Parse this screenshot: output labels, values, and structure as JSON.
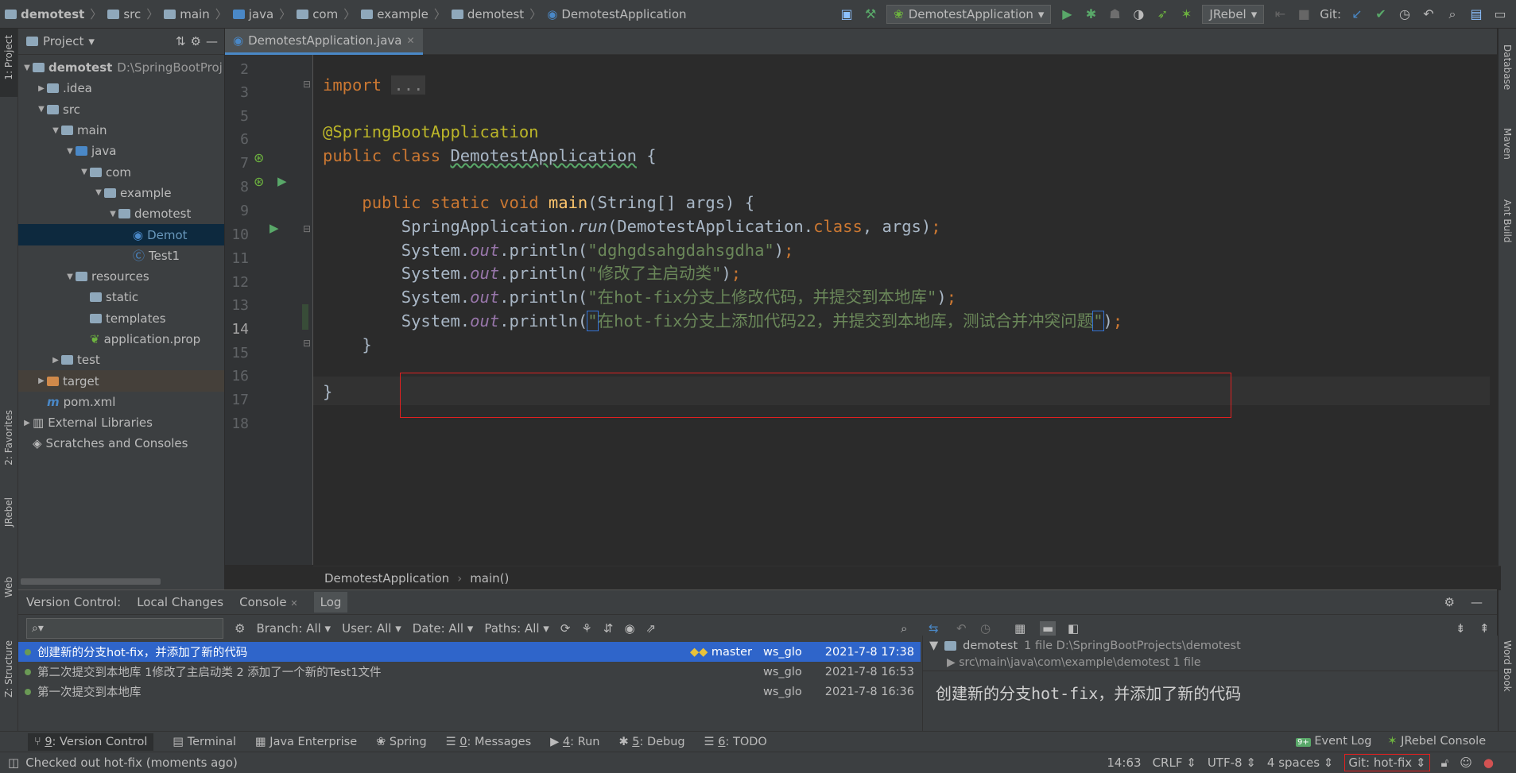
{
  "breadcrumb": [
    "demotest",
    "src",
    "main",
    "java",
    "com",
    "example",
    "demotest",
    "DemotestApplication"
  ],
  "toolbar": {
    "run_config": "DemotestApplication",
    "jrebel": "JRebel",
    "git_label": "Git:"
  },
  "left_strip": {
    "project": "1: Project",
    "favorites": "2: Favorites",
    "jrebel": "JRebel",
    "web": "Web",
    "structure": "Z: Structure"
  },
  "right_strip": {
    "database": "Database",
    "maven": "Maven",
    "ant": "Ant Build",
    "wordbook": "Word Book"
  },
  "project_panel": {
    "title": "Project",
    "tree": [
      {
        "label": "demotest",
        "extra": "D:\\SpringBootProj",
        "depth": 0,
        "arrow": "▼",
        "icon": "folder"
      },
      {
        "label": ".idea",
        "depth": 1,
        "arrow": "▶",
        "icon": "folder"
      },
      {
        "label": "src",
        "depth": 1,
        "arrow": "▼",
        "icon": "folder"
      },
      {
        "label": "main",
        "depth": 2,
        "arrow": "▼",
        "icon": "folder"
      },
      {
        "label": "java",
        "depth": 3,
        "arrow": "▼",
        "icon": "folder-blue"
      },
      {
        "label": "com",
        "depth": 4,
        "arrow": "▼",
        "icon": "folder"
      },
      {
        "label": "example",
        "depth": 5,
        "arrow": "▼",
        "icon": "folder"
      },
      {
        "label": "demotest",
        "depth": 6,
        "arrow": "▼",
        "icon": "folder"
      },
      {
        "label": "Demot",
        "depth": 7,
        "arrow": "",
        "icon": "spring-class",
        "selected": true
      },
      {
        "label": "Test1",
        "depth": 7,
        "arrow": "",
        "icon": "class"
      },
      {
        "label": "resources",
        "depth": 3,
        "arrow": "▼",
        "icon": "folder"
      },
      {
        "label": "static",
        "depth": 4,
        "arrow": "",
        "icon": "folder"
      },
      {
        "label": "templates",
        "depth": 4,
        "arrow": "",
        "icon": "folder"
      },
      {
        "label": "application.prop",
        "depth": 4,
        "arrow": "",
        "icon": "spring-leaf"
      },
      {
        "label": "test",
        "depth": 2,
        "arrow": "▶",
        "icon": "folder"
      },
      {
        "label": "target",
        "depth": 1,
        "arrow": "▶",
        "icon": "folder-orange",
        "highlight": true
      },
      {
        "label": "pom.xml",
        "depth": 1,
        "arrow": "",
        "icon": "maven"
      },
      {
        "label": "External Libraries",
        "depth": 0,
        "arrow": "▶",
        "icon": "lib"
      },
      {
        "label": "Scratches and Consoles",
        "depth": 0,
        "arrow": "",
        "icon": "scratch"
      }
    ]
  },
  "editor": {
    "tab": "DemotestApplication.java",
    "line_numbers": [
      "2",
      "3",
      "5",
      "6",
      "7",
      "8",
      "9",
      "10",
      "11",
      "12",
      "13",
      "14",
      "15",
      "16",
      "17",
      "18"
    ],
    "current_line": "14",
    "string_1": "\"dghgdsahgdahsgdha\"",
    "string_2": "\"修改了主启动类\"",
    "string_3": "\"在hot-fix分支上修改代码，并提交到本地库\"",
    "string_4": "在hot-fix分支上添加代码22，并提交到本地库，测试合并冲突问题",
    "breadcrumb_class": "DemotestApplication",
    "breadcrumb_method": "main()"
  },
  "vcs": {
    "tabs": [
      "Version Control:",
      "Local Changes",
      "Console",
      "Log"
    ],
    "filters": [
      "Branch: All",
      "User: All",
      "Date: All",
      "Paths: All"
    ],
    "log": [
      {
        "msg": "创建新的分支hot-fix，并添加了新的代码",
        "tag": "master",
        "author": "ws_glo",
        "date": "2021-7-8 17:38",
        "selected": true
      },
      {
        "msg": "第二次提交到本地库 1修改了主启动类 2 添加了一个新的Test1文件",
        "tag": "",
        "author": "ws_glo",
        "date": "2021-7-8 16:53"
      },
      {
        "msg": "第一次提交到本地库",
        "tag": "",
        "author": "ws_glo",
        "date": "2021-7-8 16:36"
      }
    ],
    "detail_root": "demotest",
    "detail_root_info": "1 file  D:\\SpringBootProjects\\demotest",
    "detail_path": "src\\main\\java\\com\\example\\demotest  1 file",
    "commit_msg": "创建新的分支hot-fix，并添加了新的代码"
  },
  "bottom_tools": [
    {
      "num": "9",
      "label": "Version Control",
      "active": true
    },
    {
      "num": "",
      "label": "Terminal"
    },
    {
      "num": "",
      "label": "Java Enterprise"
    },
    {
      "num": "",
      "label": "Spring"
    },
    {
      "num": "0",
      "label": "Messages"
    },
    {
      "num": "4",
      "label": "Run"
    },
    {
      "num": "5",
      "label": "Debug"
    },
    {
      "num": "6",
      "label": "TODO"
    }
  ],
  "bottom_right": {
    "event_badge": "9+",
    "event_log": "Event Log",
    "jrebel_console": "JRebel Console"
  },
  "status": {
    "message": "Checked out hot-fix (moments ago)",
    "position": "14:63",
    "line_sep": "CRLF",
    "encoding": "UTF-8",
    "indent": "4 spaces",
    "git": "Git: hot-fix"
  }
}
